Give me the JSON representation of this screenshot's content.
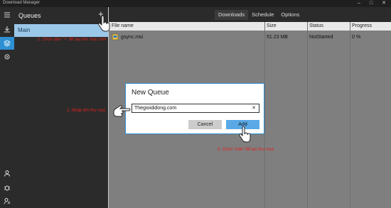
{
  "window": {
    "title": "Download Manager",
    "controls": [
      "–",
      "□",
      "✕"
    ]
  },
  "rail": {
    "icons": [
      "menu-icon",
      "download-icon",
      "queue-icon",
      "settings-icon",
      "user-icon",
      "bug-icon",
      "feedback-icon"
    ]
  },
  "queues": {
    "header": "Queues",
    "add_label": "+",
    "items": [
      "Main"
    ]
  },
  "tabs": [
    "Downloads",
    "Schedule",
    "Options"
  ],
  "table": {
    "columns": [
      "File name",
      "Size",
      "Status",
      "Progress"
    ],
    "rows": [
      {
        "name": "gsync.msi",
        "size": "51.23 MB",
        "status": "NotStarted",
        "progress": "0 %"
      }
    ]
  },
  "dialog": {
    "title": "New Queue",
    "input_value": "Thegioididong.com",
    "clear_label": "✕",
    "cancel_label": "Cancel",
    "add_label": "Add"
  },
  "annotations": {
    "step1": "1. Chọn dấu \"+\" để tạo thư mục mới",
    "step2": "2. Nhập tên thư mục",
    "step3": "3. Chọn \"Add\" để tạo thư mục"
  },
  "colors": {
    "accent": "#2e8fd3",
    "selected_queue": "#9bc7e8",
    "annotation": "#e02020"
  }
}
